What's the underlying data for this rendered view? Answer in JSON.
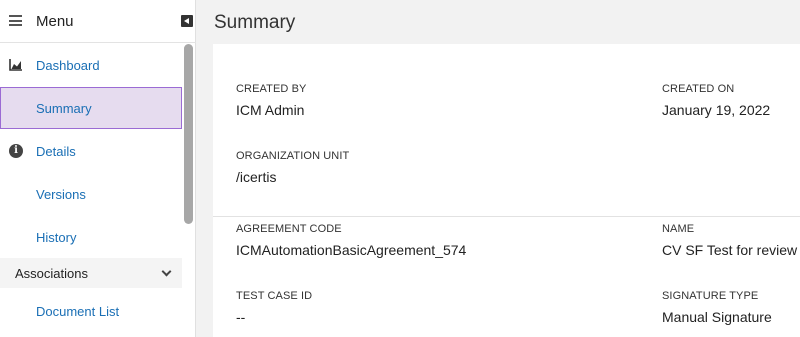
{
  "sidebar": {
    "title": "Menu",
    "items": [
      {
        "label": "Dashboard",
        "icon": "chart-icon"
      },
      {
        "label": "Summary"
      },
      {
        "label": "Details",
        "icon": "info-icon"
      },
      {
        "label": "Versions"
      },
      {
        "label": "History"
      }
    ],
    "section": {
      "label": "Associations"
    },
    "section_items": [
      {
        "label": "Document List"
      }
    ]
  },
  "main": {
    "title": "Summary",
    "fields": {
      "created_by": {
        "label": "CREATED BY",
        "value": "ICM Admin"
      },
      "created_on": {
        "label": "CREATED ON",
        "value": "January 19, 2022"
      },
      "org_unit": {
        "label": "ORGANIZATION UNIT",
        "value": "/icertis"
      },
      "agreement_code": {
        "label": "AGREEMENT CODE",
        "value": "ICMAutomationBasicAgreement_574"
      },
      "name": {
        "label": "NAME",
        "value": "CV SF Test for review"
      },
      "test_case_id": {
        "label": "TEST CASE ID",
        "value": "--"
      },
      "signature_type": {
        "label": "SIGNATURE TYPE",
        "value": "Manual Signature"
      }
    }
  },
  "colors": {
    "link": "#1a6fb5",
    "active_bg": "#e6dcef",
    "active_border": "#9b6bd4"
  }
}
